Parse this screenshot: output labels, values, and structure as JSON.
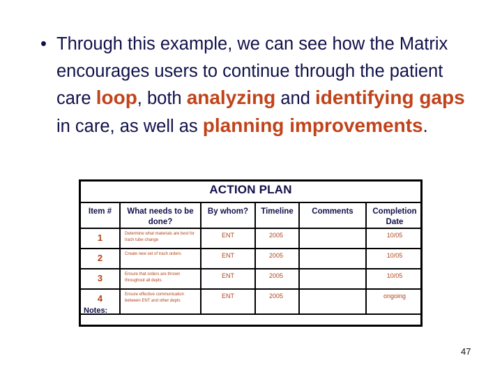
{
  "bullet": {
    "marker": "•",
    "segments": [
      {
        "text": "Through this example, we can see how the Matrix encourages users to continue through the patient care ",
        "style": "normal"
      },
      {
        "text": "loop",
        "style": "emphasis-big"
      },
      {
        "text": ", both ",
        "style": "normal"
      },
      {
        "text": "analyzing",
        "style": "emphasis-big"
      },
      {
        "text": " and ",
        "style": "normal"
      },
      {
        "text": "identifying gaps",
        "style": "emphasis-big"
      },
      {
        "text": " in care, as well as ",
        "style": "normal"
      },
      {
        "text": "planning improvements",
        "style": "emphasis-big"
      },
      {
        "text": ".",
        "style": "normal"
      }
    ],
    "colors": {
      "text": "#10104a",
      "emphasis": "#c0431a"
    }
  },
  "action_plan": {
    "title": "ACTION PLAN",
    "headers": {
      "item": "Item #",
      "what": "What needs to be done?",
      "who": "By whom?",
      "timeline": "Timeline",
      "comments": "Comments",
      "completion": "Completion Date"
    },
    "rows": [
      {
        "item": "1",
        "what": "Determine what materials are best for trach tube change",
        "who": "ENT",
        "timeline": "2005",
        "comments": "",
        "completion": "10/05"
      },
      {
        "item": "2",
        "what": "Create new set of trach orders",
        "who": "ENT",
        "timeline": "2005",
        "comments": "",
        "completion": "10/05"
      },
      {
        "item": "3",
        "what": "Ensure that orders are thrown throughout all depts",
        "who": "ENT",
        "timeline": "2005",
        "comments": "",
        "completion": "10/05"
      },
      {
        "item": "4",
        "what": "Ensure effective communication between ENT and other depts",
        "who": "ENT",
        "timeline": "2005",
        "comments": "",
        "completion": "ongoing"
      }
    ],
    "notes_label": "Notes:"
  },
  "page_number": "47"
}
